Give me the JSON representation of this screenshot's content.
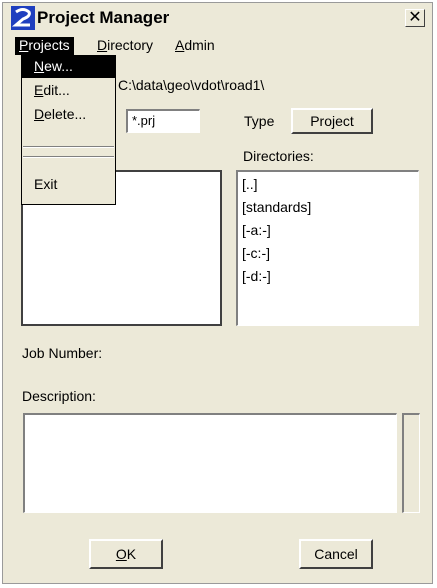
{
  "window": {
    "title": "Project Manager",
    "close_glyph": "✕"
  },
  "menubar": {
    "items": [
      {
        "label_u": "P",
        "label_rest": "rojects"
      },
      {
        "label_u": "D",
        "label_rest": "irectory"
      },
      {
        "label_u": "A",
        "label_rest": "dmin"
      }
    ]
  },
  "projects_menu": {
    "items": [
      {
        "label_u": "N",
        "label_rest": "ew..."
      },
      {
        "label_u": "E",
        "label_rest": "dit..."
      },
      {
        "label_u": "D",
        "label_rest": "elete..."
      },
      {
        "label_u": "",
        "label_rest": "Exit"
      }
    ]
  },
  "path": "C:\\data\\geo\\vdot\\road1\\",
  "filter": {
    "value": "*.prj"
  },
  "type": {
    "label": "Type",
    "button": "Project"
  },
  "directories": {
    "label": "Directories:",
    "items": [
      "[..]",
      "[standards]",
      "[-a:-]",
      "[-c:-]",
      "[-d:-]"
    ]
  },
  "job_number": {
    "label": "Job Number:"
  },
  "description": {
    "label": "Description:"
  },
  "buttons": {
    "ok_u": "O",
    "ok_rest": "K",
    "cancel": "Cancel"
  },
  "colors": {
    "dialog_bg": "#ece9d8",
    "icon_blue": "#1f3fbf"
  }
}
